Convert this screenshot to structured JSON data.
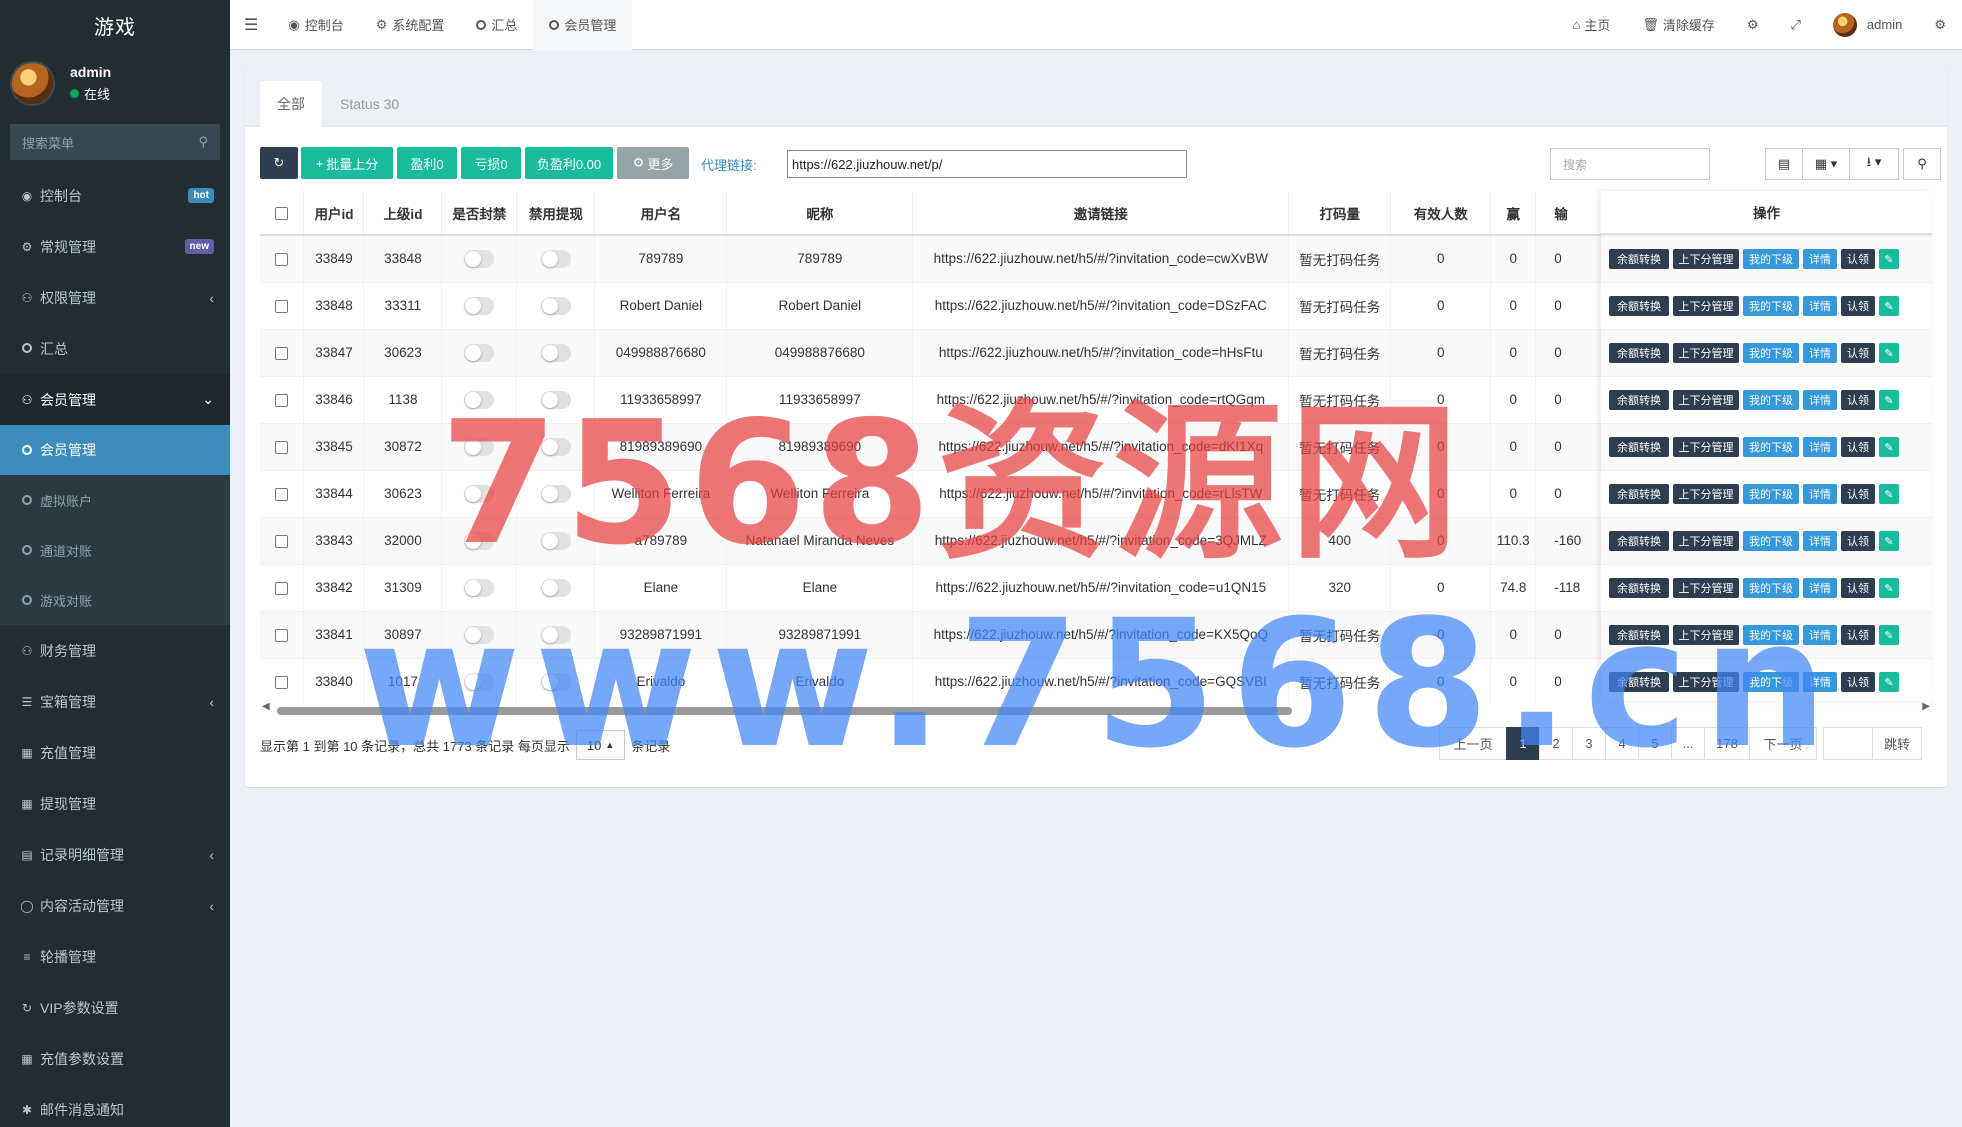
{
  "app": {
    "title": "游戏"
  },
  "user": {
    "name": "admin",
    "status": "在线"
  },
  "sidebar": {
    "search_placeholder": "搜索菜单",
    "items": [
      {
        "label": "控制台",
        "icon": "dashboard-icon",
        "badge": "hot"
      },
      {
        "label": "常规管理",
        "icon": "cogs-icon",
        "badge": "new"
      },
      {
        "label": "权限管理",
        "icon": "group-icon",
        "arrow": "‹"
      },
      {
        "label": "汇总",
        "icon": "circle-icon"
      },
      {
        "label": "会员管理",
        "icon": "users-icon",
        "arrow": "⌄"
      }
    ],
    "submenu": [
      {
        "label": "会员管理",
        "active": true
      },
      {
        "label": "虚拟账户"
      },
      {
        "label": "通道对账"
      },
      {
        "label": "游戏对账"
      }
    ],
    "items_after": [
      {
        "label": "财务管理",
        "icon": "users-icon"
      },
      {
        "label": "宝箱管理",
        "icon": "list-icon",
        "arrow": "‹"
      },
      {
        "label": "充值管理",
        "icon": "grid-icon"
      },
      {
        "label": "提现管理",
        "icon": "bank-icon"
      },
      {
        "label": "记录明细管理",
        "icon": "chart-icon",
        "arrow": "‹"
      },
      {
        "label": "内容活动管理",
        "icon": "dribbble-icon",
        "arrow": "‹"
      },
      {
        "label": "轮播管理",
        "icon": "bars-icon"
      },
      {
        "label": "VIP参数设置",
        "icon": "refresh-icon"
      },
      {
        "label": "充值参数设置",
        "icon": "grid-icon"
      },
      {
        "label": "邮件消息通知",
        "icon": "gear-icon"
      }
    ]
  },
  "topbar": {
    "tabs": [
      "控制台",
      "系统配置",
      "汇总",
      "会员管理"
    ],
    "right": {
      "home": "主页",
      "clear_cache": "清除缓存",
      "user": "admin"
    }
  },
  "content": {
    "tabs": [
      "全部",
      "Status 30"
    ],
    "toolbar": {
      "batch": "批量上分",
      "profit": "盈利0",
      "loss": "亏损0",
      "neg_profit": "负盈利0.00",
      "more": "更多",
      "proxy_label": "代理链接:",
      "proxy_value": "https://622.jiuzhouw.net/p/",
      "search_placeholder": "搜索"
    },
    "columns": [
      "用户id",
      "上级id",
      "是否封禁",
      "禁用提现",
      "用户名",
      "昵称",
      "邀请链接",
      "打码量",
      "有效人数",
      "赢",
      "输",
      "操作"
    ],
    "rows": [
      {
        "id": "33849",
        "parent": "33848",
        "username": "789789",
        "nickname": "789789",
        "link": "https://622.jiuzhouw.net/h5/#/?invitation_code=cwXvBW",
        "bet": "暂无打码任务",
        "valid": "0",
        "win": "0",
        "lose": "0"
      },
      {
        "id": "33848",
        "parent": "33311",
        "username": "Robert Daniel",
        "nickname": "Robert Daniel",
        "link": "https://622.jiuzhouw.net/h5/#/?invitation_code=DSzFAC",
        "bet": "暂无打码任务",
        "valid": "0",
        "win": "0",
        "lose": "0"
      },
      {
        "id": "33847",
        "parent": "30623",
        "username": "049988876680",
        "nickname": "049988876680",
        "link": "https://622.jiuzhouw.net/h5/#/?invitation_code=hHsFtu",
        "bet": "暂无打码任务",
        "valid": "0",
        "win": "0",
        "lose": "0"
      },
      {
        "id": "33846",
        "parent": "1138",
        "username": "11933658997",
        "nickname": "11933658997",
        "link": "https://622.jiuzhouw.net/h5/#/?invitation_code=rtQGqm",
        "bet": "暂无打码任务",
        "valid": "0",
        "win": "0",
        "lose": "0"
      },
      {
        "id": "33845",
        "parent": "30872",
        "username": "81989389690",
        "nickname": "81989389690",
        "link": "https://622.jiuzhouw.net/h5/#/?invitation_code=dKI1Xq",
        "bet": "暂无打码任务",
        "valid": "0",
        "win": "0",
        "lose": "0"
      },
      {
        "id": "33844",
        "parent": "30623",
        "username": "Welliton Ferreira",
        "nickname": "Welliton Ferreira",
        "link": "https://622.jiuzhouw.net/h5/#/?invitation_code=rLlsTW",
        "bet": "暂无打码任务",
        "valid": "0",
        "win": "0",
        "lose": "0"
      },
      {
        "id": "33843",
        "parent": "32000",
        "username": "a789789",
        "nickname": "Natanael Miranda Neves",
        "link": "https://622.jiuzhouw.net/h5/#/?invitation_code=3QJMLZ",
        "bet": "400",
        "valid": "0",
        "win": "110.3",
        "lose": "-160"
      },
      {
        "id": "33842",
        "parent": "31309",
        "username": "Elane",
        "nickname": "Elane",
        "link": "https://622.jiuzhouw.net/h5/#/?invitation_code=u1QN15",
        "bet": "320",
        "valid": "0",
        "win": "74.8",
        "lose": "-118"
      },
      {
        "id": "33841",
        "parent": "30897",
        "username": "93289871991",
        "nickname": "93289871991",
        "link": "https://622.jiuzhouw.net/h5/#/?invitation_code=KX5QoQ",
        "bet": "暂无打码任务",
        "valid": "0",
        "win": "0",
        "lose": "0"
      },
      {
        "id": "33840",
        "parent": "1017",
        "username": "Erivaldo",
        "nickname": "Erivaldo",
        "link": "https://622.jiuzhouw.net/h5/#/?invitation_code=GQSVBI",
        "bet": "暂无打码任务",
        "valid": "0",
        "win": "0",
        "lose": "0"
      }
    ],
    "ops": [
      "余额转换",
      "上下分管理",
      "我的下级",
      "详情",
      "认领"
    ],
    "footer": {
      "summary_pre": "显示第 1 到第 10 条记录，总共 1773 条记录 每页显示",
      "page_size": "10",
      "summary_post": "条记录"
    },
    "pager": {
      "prev": "上一页",
      "pages": [
        "1",
        "2",
        "3",
        "4",
        "5",
        "...",
        "178"
      ],
      "next": "下一页",
      "jump": "跳转"
    }
  },
  "watermark": {
    "line1": "7568资源网",
    "line2": "www.7568.cn"
  }
}
